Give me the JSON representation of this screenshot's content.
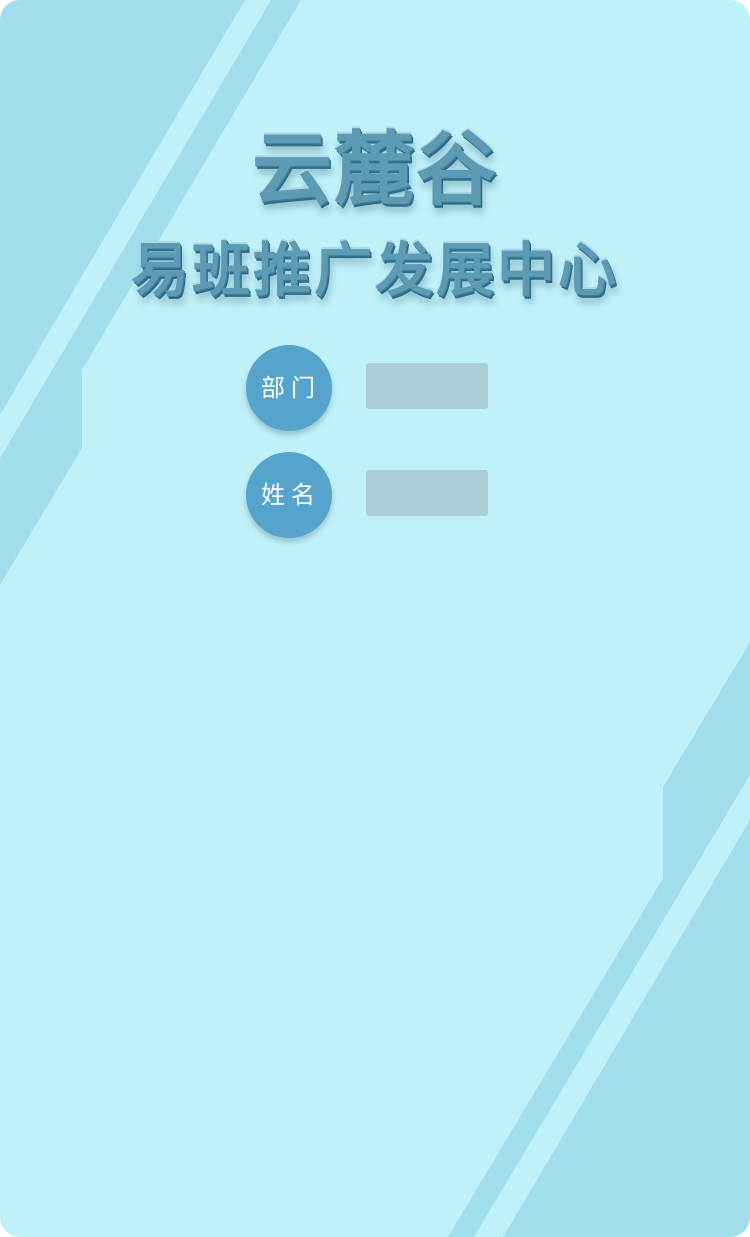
{
  "title": {
    "line1": "云麓谷",
    "line2": "易班推广发展中心"
  },
  "form": {
    "department": {
      "label": "部门",
      "value": "",
      "placeholder": ""
    },
    "name": {
      "label": "姓名",
      "value": "",
      "placeholder": ""
    }
  },
  "colors": {
    "background": "#c0f1f8",
    "stripe": "#a1deec",
    "badge": "#56a3cc",
    "field": "#abcfd5",
    "title": "#5d9ab4"
  }
}
